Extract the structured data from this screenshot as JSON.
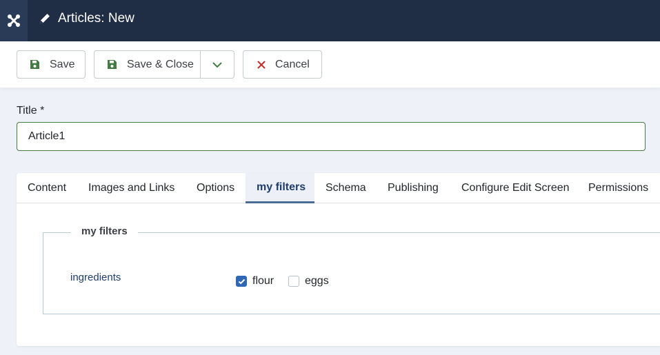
{
  "header": {
    "title": "Articles: New"
  },
  "toolbar": {
    "save_label": "Save",
    "save_close_label": "Save & Close",
    "cancel_label": "Cancel"
  },
  "title_field": {
    "label": "Title *",
    "value": "Article1"
  },
  "tabs": [
    {
      "label": "Content",
      "active": false
    },
    {
      "label": "Images and Links",
      "active": false
    },
    {
      "label": "Options",
      "active": false
    },
    {
      "label": "my filters",
      "active": true
    },
    {
      "label": "Schema",
      "active": false
    },
    {
      "label": "Publishing",
      "active": false
    },
    {
      "label": "Configure Edit Screen",
      "active": false
    },
    {
      "label": "Permissions",
      "active": false
    }
  ],
  "fieldset": {
    "legend": "my filters",
    "field_label": "ingredients",
    "options": [
      {
        "label": "flour",
        "checked": true
      },
      {
        "label": "eggs",
        "checked": false
      }
    ]
  },
  "colors": {
    "header_bg": "#1f2d45",
    "accent_green": "#447a44",
    "cancel_red": "#c52827",
    "tab_active": "#1f3d6b",
    "checkbox_on": "#2f67b4"
  }
}
